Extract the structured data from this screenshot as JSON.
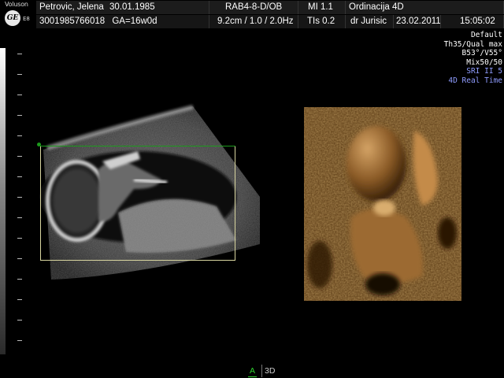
{
  "brand": {
    "name": "Voluson",
    "logo": "GE",
    "model": "E8",
    "logo_icon": "ge-logo-icon"
  },
  "header": {
    "row1": {
      "patient": "Petrovic, Jelena",
      "dob": "30.01.1985",
      "probe": "RAB4-8-D/OB",
      "mi": "MI  1.1",
      "institution": "Ordinacija 4D"
    },
    "row2": {
      "patient_id": "3001985766018",
      "ga": "GA=16w0d",
      "depth": "9.2cm / 1.0 / 2.0Hz",
      "tis": "TIs  0.2",
      "doctor": "dr Jurisic",
      "date": "23.02.2011",
      "time": "15:05:02"
    }
  },
  "info_panel": {
    "lines_white": [
      "Default",
      "Th35/Qual max",
      "B53°/V55°",
      "Mix50/50"
    ],
    "lines_blue": [
      "SRI II 5",
      "4D Real Time"
    ]
  },
  "mode_tabs": {
    "a_label": "A",
    "threed_label": "3D",
    "active": "A"
  },
  "colors": {
    "roi_border": "#d9d6a0",
    "roi_marker": "#1c9a1c",
    "active_tab": "#2fd12f",
    "info_blue": "#8f9cff",
    "render_tone": "#8a5a26"
  }
}
